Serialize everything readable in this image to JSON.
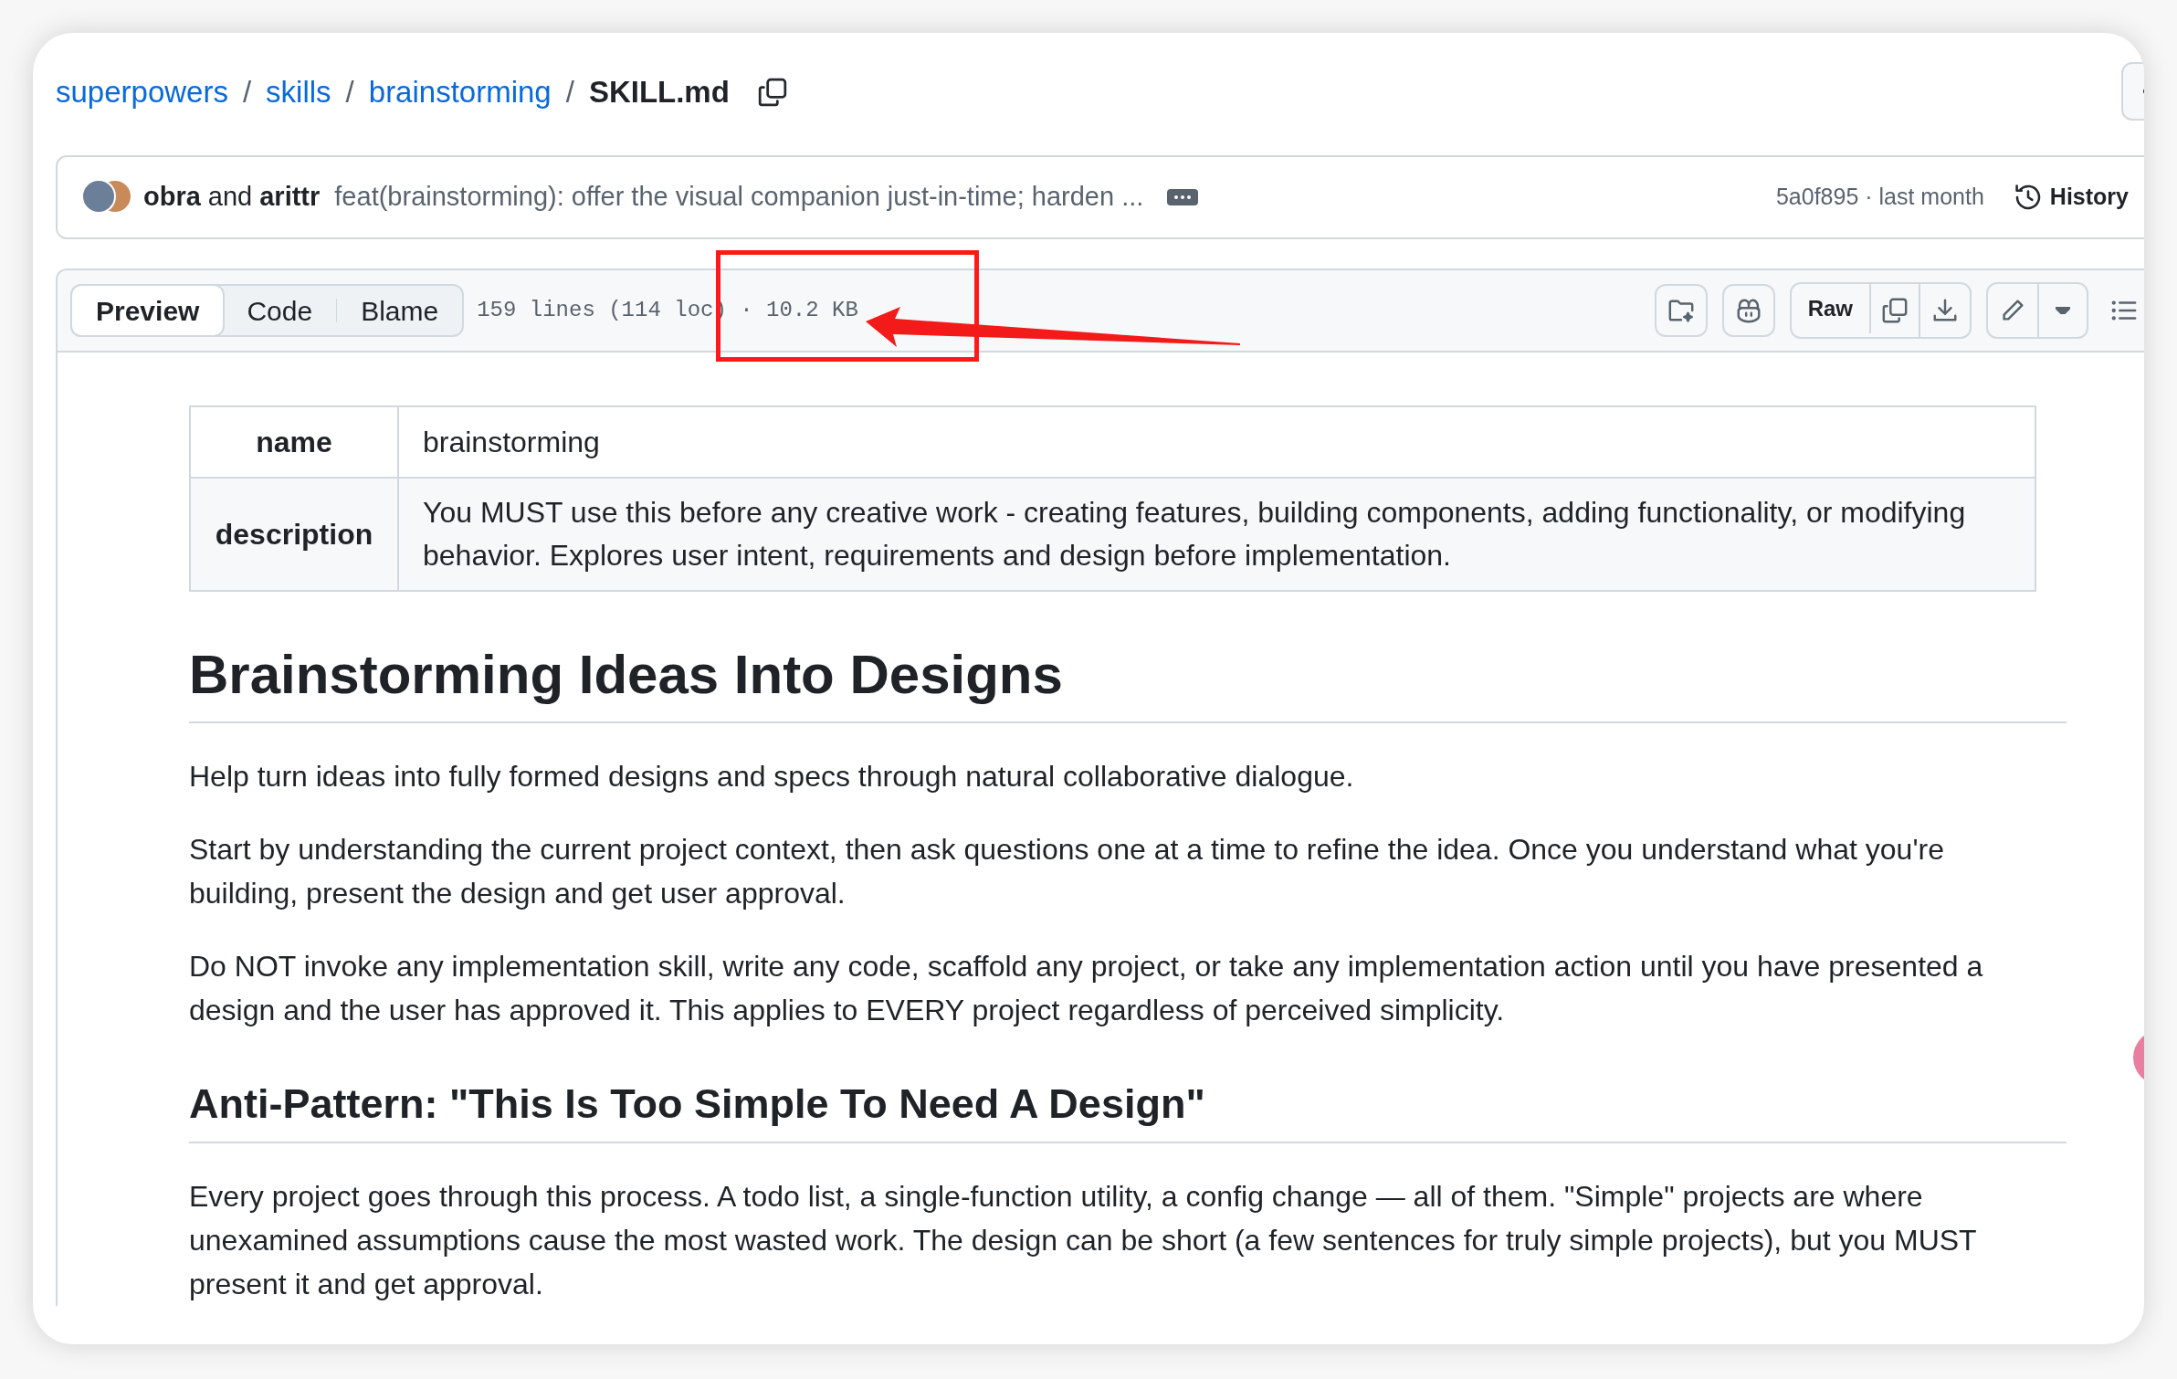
{
  "breadcrumb": [
    {
      "text": "superpowers",
      "kind": "link"
    },
    {
      "separator": "/",
      "text": "skills",
      "kind": "link"
    },
    {
      "separator": "/",
      "text": "brainstorming",
      "kind": "link"
    },
    {
      "separator": "/",
      "text": "SKILL.md",
      "kind": "current"
    }
  ],
  "commit": {
    "author_1": "obra",
    "joiner": "and",
    "author_2": "arittr",
    "message": "feat(brainstorming): offer the visual companion just-in-time; harden ...",
    "sha_time": "5a0f895 · last month",
    "history": "History"
  },
  "toolbar": {
    "tabs": [
      {
        "label": "Preview",
        "selected": true
      },
      {
        "label": "Code",
        "selected": false
      },
      {
        "label": "Blame",
        "selected": false
      }
    ],
    "file_info": "159 lines (114 loc) · 10.2 KB",
    "raw": "Raw"
  },
  "frontmatter": [
    {
      "key": "name",
      "value": "brainstorming"
    },
    {
      "key": "description",
      "value": "You MUST use this before any creative work - creating features, building components, adding functionality, or modifying behavior. Explores user intent, requirements and design before implementation."
    }
  ],
  "blocks": [
    {
      "kind": "h1",
      "text": "Brainstorming Ideas Into Designs"
    },
    {
      "kind": "p",
      "text": "Help turn ideas into fully formed designs and specs through natural collaborative dialogue."
    },
    {
      "kind": "p",
      "text": "Start by understanding the current project context, then ask questions one at a time to refine the idea. Once you understand what you're building, present the design and get user approval."
    },
    {
      "kind": "p",
      "text": "Do NOT invoke any implementation skill, write any code, scaffold any project, or take any implementation action until you have presented a design and the user has approved it. This applies to EVERY project regardless of perceived simplicity."
    },
    {
      "kind": "h2",
      "text": "Anti-Pattern: \"This Is Too Simple To Need A Design\""
    },
    {
      "kind": "p",
      "text": "Every project goes through this process. A todo list, a single-function utility, a config change — all of them. \"Simple\" projects are where unexamined assumptions cause the most wasted work. The design can be short (a few sentences for truly simple projects), but you MUST present it and get approval."
    }
  ]
}
